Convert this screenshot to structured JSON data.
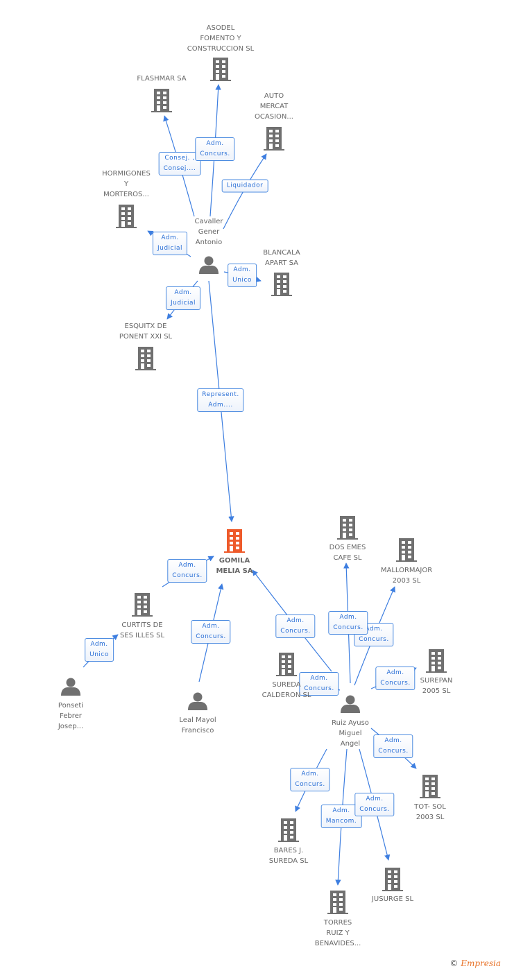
{
  "colors": {
    "edge": "#3d7ee0",
    "node_icon": "#707070",
    "focus_company": "#ee5a2a",
    "label_text": "#666666"
  },
  "nodes": [
    {
      "type": "company",
      "label": [
        "ASODEL",
        "FOMENTO Y",
        "CONSTRUCCION SL"
      ]
    },
    {
      "type": "company",
      "label": [
        "FLASHMAR SA"
      ]
    },
    {
      "type": "company",
      "label": [
        "AUTO",
        "MERCAT",
        "OCASION..."
      ]
    },
    {
      "type": "company",
      "label": [
        "HORMIGONES",
        "Y",
        "MORTEROS..."
      ]
    },
    {
      "type": "person",
      "label": [
        "Cavaller",
        "Gener",
        "Antonio"
      ]
    },
    {
      "type": "company",
      "label": [
        "BLANCALA",
        "APART SA"
      ]
    },
    {
      "type": "company",
      "label": [
        "ESQUITX DE",
        "PONENT XXI SL"
      ]
    },
    {
      "type": "focus",
      "label": [
        "GOMILA",
        "MELIA SA"
      ]
    },
    {
      "type": "company",
      "label": [
        "CURTITS DE",
        "SES ILLES SL"
      ]
    },
    {
      "type": "person",
      "label": [
        "Ponseti",
        "Febrer",
        "Josep..."
      ]
    },
    {
      "type": "person",
      "label": [
        "Leal Mayol",
        "Francisco"
      ]
    },
    {
      "type": "company",
      "label": [
        "DOS EMES",
        "CAFE SL"
      ]
    },
    {
      "type": "company",
      "label": [
        "MALLORMAJOR",
        "2003 SL"
      ]
    },
    {
      "type": "company",
      "label": [
        "SUREDA",
        "CALDERON SL"
      ]
    },
    {
      "type": "company",
      "label": [
        "SUREPAN",
        "2005 SL"
      ]
    },
    {
      "type": "person",
      "label": [
        "Ruiz Ayuso",
        "Miguel",
        "Angel"
      ]
    },
    {
      "type": "company",
      "label": [
        "TOT- SOL",
        "2003 SL"
      ]
    },
    {
      "type": "company",
      "label": [
        "BARES J.",
        "SUREDA SL"
      ]
    },
    {
      "type": "company",
      "label": [
        "JUSURGE SL"
      ]
    },
    {
      "type": "company",
      "label": [
        "TORRES",
        "RUIZ Y",
        "BENAVIDES..."
      ]
    }
  ],
  "edges": [
    {
      "from": "Cavaller Gener Antonio",
      "to": "FLASHMAR SA",
      "label": [
        "Consej. ,",
        "Consej...."
      ]
    },
    {
      "from": "Cavaller Gener Antonio",
      "to": "ASODEL FOMENTO Y CONSTRUCCION SL",
      "label": [
        "Adm.",
        "Concurs."
      ]
    },
    {
      "from": "Cavaller Gener Antonio",
      "to": "AUTO MERCAT OCASION...",
      "label": [
        "Liquidador"
      ]
    },
    {
      "from": "Cavaller Gener Antonio",
      "to": "HORMIGONES Y MORTEROS...",
      "label": [
        "Adm.",
        "Judicial"
      ]
    },
    {
      "from": "Cavaller Gener Antonio",
      "to": "BLANCALA APART SA",
      "label": [
        "Adm.",
        "Unico"
      ]
    },
    {
      "from": "Cavaller Gener Antonio",
      "to": "ESQUITX DE PONENT XXI SL",
      "label": [
        "Adm.",
        "Judicial"
      ]
    },
    {
      "from": "Cavaller Gener Antonio",
      "to": "GOMILA MELIA SA",
      "label": [
        "Represent.",
        "Adm...."
      ]
    },
    {
      "from": "Ponseti Febrer Josep...",
      "to": "CURTITS DE SES ILLES SL",
      "label": [
        "Adm.",
        "Unico"
      ]
    },
    {
      "from": "CURTITS DE SES ILLES SL",
      "to": "GOMILA MELIA SA",
      "label": [
        "Adm.",
        "Concurs."
      ]
    },
    {
      "from": "Leal Mayol Francisco",
      "to": "GOMILA MELIA SA",
      "label": [
        "Adm.",
        "Concurs."
      ]
    },
    {
      "from": "Ruiz Ayuso Miguel Angel",
      "to": "GOMILA MELIA SA",
      "label": [
        "Adm.",
        "Concurs."
      ]
    },
    {
      "from": "Ruiz Ayuso Miguel Angel",
      "to": "MALLORMAJOR 2003 SL",
      "label": [
        "Adm.",
        "Concurs."
      ]
    },
    {
      "from": "Ruiz Ayuso Miguel Angel",
      "to": "DOS EMES CAFE SL",
      "label": [
        "Adm.",
        "Concurs."
      ]
    },
    {
      "from": "Ruiz Ayuso Miguel Angel",
      "to": "SUREDA CALDERON SL",
      "label": [
        "Adm.",
        "Concurs."
      ]
    },
    {
      "from": "Ruiz Ayuso Miguel Angel",
      "to": "SUREPAN 2005 SL",
      "label": [
        "Adm.",
        "Concurs."
      ]
    },
    {
      "from": "Ruiz Ayuso Miguel Angel",
      "to": "TOT- SOL 2003 SL",
      "label": [
        "Adm.",
        "Concurs."
      ]
    },
    {
      "from": "Ruiz Ayuso Miguel Angel",
      "to": "BARES J. SUREDA SL",
      "label": [
        "Adm.",
        "Concurs."
      ]
    },
    {
      "from": "Ruiz Ayuso Miguel Angel",
      "to": "TORRES RUIZ Y BENAVIDES...",
      "label": [
        "Adm.",
        "Mancom."
      ]
    },
    {
      "from": "Ruiz Ayuso Miguel Angel",
      "to": "JUSURGE SL",
      "label": [
        "Adm.",
        "Concurs."
      ]
    }
  ],
  "footer": {
    "copyright": "©",
    "brand": "Empresia"
  }
}
